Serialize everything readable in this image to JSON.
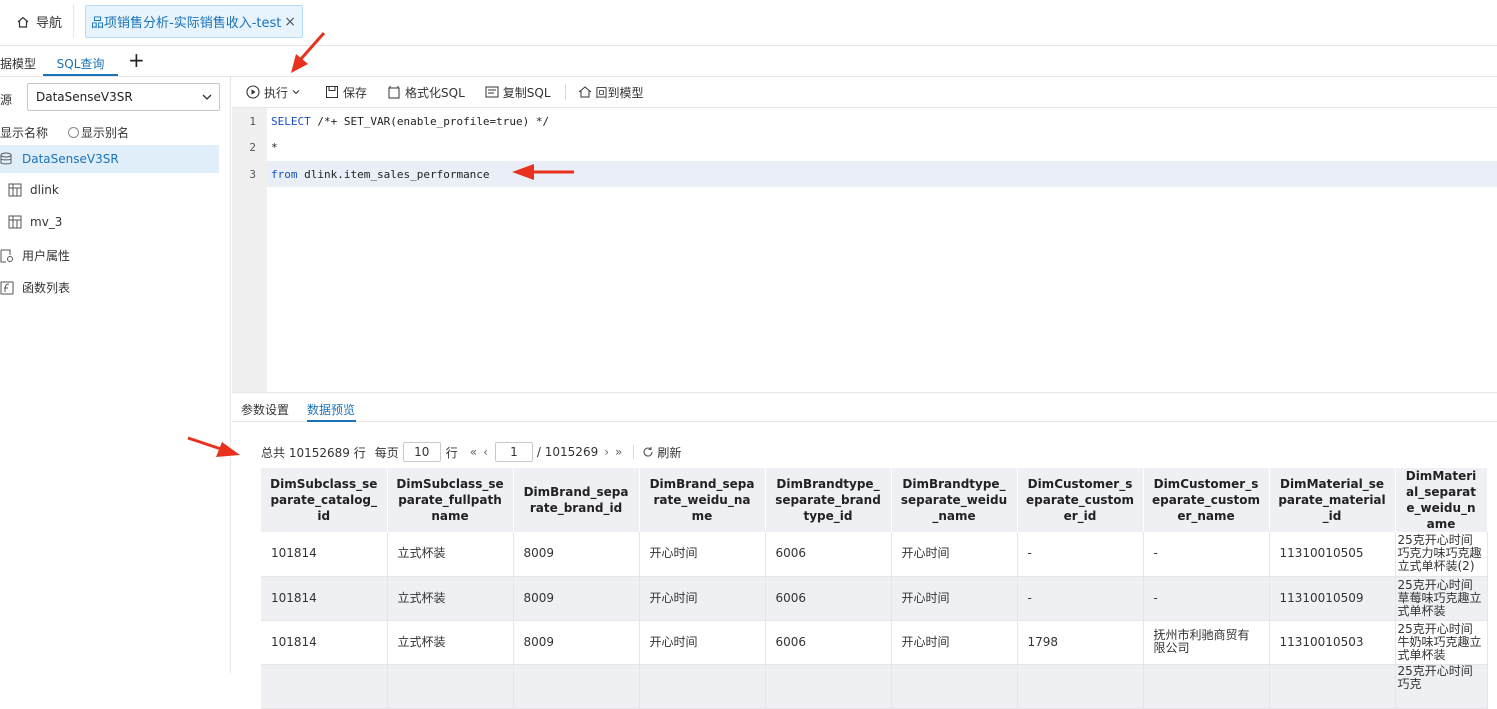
{
  "tabs": {
    "nav_label": "导航",
    "active_label": "品项销售分析-实际销售收入-test",
    "close_glyph": "×"
  },
  "subtabs": {
    "model_label": "据模型",
    "sql_label": "SQL查询",
    "add_glyph": "+"
  },
  "left_panel": {
    "source_label": "源",
    "source_value": "DataSenseV3SR",
    "show_name_label": "显示名称",
    "show_alias_label": "显示别名",
    "tree_root": "DataSenseV3SR",
    "tree_items": [
      "dlink",
      "mv_3",
      "用户属性",
      "函数列表"
    ]
  },
  "toolbar": {
    "execute_label": "执行",
    "save_label": "保存",
    "format_label": "格式化SQL",
    "copy_label": "复制SQL",
    "back_label": "回到模型"
  },
  "editor": {
    "line_numbers": [
      "1",
      "2",
      "3"
    ],
    "line1_kw": "SELECT",
    "line1_rest": " /*+ SET_VAR(enable_profile=true) */",
    "line2": "*",
    "line3_kw": "from",
    "line3_rest": " dlink.item_sales_performance"
  },
  "bottom_tabs": {
    "params_label": "参数设置",
    "preview_label": "数据预览"
  },
  "pager": {
    "total_prefix": "总共 10152689 行",
    "per_page_label": "每页",
    "per_page_value": "10",
    "row_unit": "行",
    "current_page": "1",
    "total_pages": "/ 1015269",
    "refresh_label": "刷新"
  },
  "table": {
    "columns": [
      "DimSubclass_separate_catalog_id",
      "DimSubclass_separate_fullpathname",
      "DimBrand_separate_brand_id",
      "DimBrand_separate_weidu_name",
      "DimBrandtype_separate_brandtype_id",
      "DimBrandtype_separate_weidu_name",
      "DimCustomer_separate_customer_id",
      "DimCustomer_separate_customer_name",
      "DimMaterial_separate_material_id",
      "DimMaterial_separate_weidu_name"
    ],
    "rows": [
      [
        "101814",
        "立式杯装",
        "8009",
        "开心时间",
        "6006",
        "开心时间",
        "-",
        "-",
        "11310010505",
        "25克开心时间巧克力味巧克趣立式单杯装(2)"
      ],
      [
        "101814",
        "立式杯装",
        "8009",
        "开心时间",
        "6006",
        "开心时间",
        "-",
        "-",
        "11310010509",
        "25克开心时间草莓味巧克趣立式单杯装"
      ],
      [
        "101814",
        "立式杯装",
        "8009",
        "开心时间",
        "6006",
        "开心时间",
        "1798",
        "抚州市利驰商贸有限公司",
        "11310010503",
        "25克开心时间牛奶味巧克趣立式单杯装"
      ],
      [
        "",
        "",
        "",
        "",
        "",
        "",
        "",
        "",
        "",
        "25克开心时间巧克"
      ]
    ]
  },
  "colors": {
    "accent": "#1a73b8",
    "arrow": "#e8321e",
    "header_bg": "#eef0f3"
  }
}
